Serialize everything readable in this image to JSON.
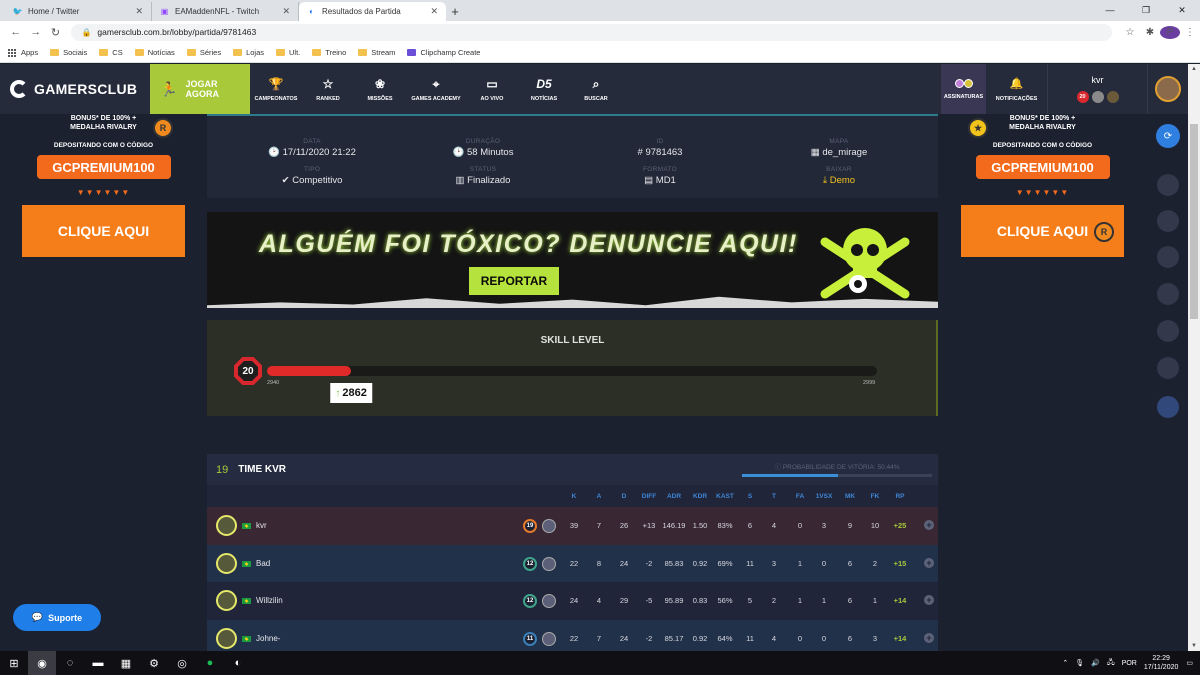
{
  "browser": {
    "tabs": [
      {
        "title": "Home / Twitter",
        "icon": "twitter-icon",
        "active": false
      },
      {
        "title": "EAMaddenNFL - Twitch",
        "icon": "twitch-icon",
        "active": false
      },
      {
        "title": "Resultados da Partida",
        "icon": "gc-icon",
        "active": true
      }
    ],
    "url": "gamersclub.com.br/lobby/partida/9781463",
    "profile_initial": "P",
    "bookmarks": [
      "Apps",
      "Sociais",
      "CS",
      "Notícias",
      "Séries",
      "Lojas",
      "Ult.",
      "Treino",
      "Stream",
      "Clipchamp Create"
    ]
  },
  "site": {
    "logo": "GAMERSCLUB",
    "play_label": "JOGAR AGORA",
    "nav": [
      {
        "label": "CAMPEONATOS",
        "icon": "trophy-icon",
        "glyph": "🏆"
      },
      {
        "label": "RANKED",
        "icon": "star-icon",
        "glyph": "☆"
      },
      {
        "label": "MISSÕES",
        "icon": "medal-icon",
        "glyph": "❀"
      },
      {
        "label": "GAMES ACADEMY",
        "icon": "pin-icon",
        "glyph": "⌖"
      },
      {
        "label": "AO VIVO",
        "icon": "monitor-icon",
        "glyph": "▭"
      },
      {
        "label": "NOTÍCIAS",
        "icon": "news-icon",
        "glyph": "D5"
      },
      {
        "label": "BUSCAR",
        "icon": "search-icon",
        "glyph": "⌕"
      }
    ],
    "subs_label": "ASSINATURAS",
    "notif_label": "NOTIFICAÇÕES",
    "username": "kvr",
    "user_level": "20"
  },
  "ads": {
    "bonus": "BONUS* DE 100% + MEDALHA RIVALRY",
    "code_label": "DEPOSITANDO COM O CÓDIGO",
    "code": "GCPREMIUM100",
    "arrows": "▼▼▼▼▼▼",
    "cta": "CLIQUE AQUI"
  },
  "match": {
    "data_label": "DATA",
    "data": "17/11/2020 21:22",
    "duracao_label": "DURAÇÃO",
    "duracao": "58 Minutos",
    "id_label": "ID",
    "id": "9781463",
    "mapa_label": "MAPA",
    "mapa": "de_mirage",
    "tipo_label": "TIPO",
    "tipo": "Competitivo",
    "status_label": "STATUS",
    "status": "Finalizado",
    "formato_label": "FORMATO",
    "formato": "MD1",
    "baixar_label": "BAIXAR",
    "baixar": "Demo"
  },
  "report": {
    "headline": "ALGUÉM FOI TÓXICO? DENUNCIE AQUI!",
    "button": "REPORTAR"
  },
  "skill": {
    "title": "SKILL LEVEL",
    "level": "20",
    "min": "2940",
    "max": "2999",
    "current": "2862",
    "progress": 0.138
  },
  "team": {
    "number": "19",
    "name": "TIME KVR",
    "win_prob_label": "PROBABILIDADE DE VITÓRIA: 50.44%",
    "win_prob": 0.5044,
    "columns": [
      "K",
      "A",
      "D",
      "DIFF",
      "ADR",
      "KDR",
      "KAST",
      "S",
      "T",
      "FA",
      "1VSX",
      "MK",
      "FK",
      "RP"
    ],
    "players": [
      {
        "name": "kvr",
        "level": "19",
        "badge_color": "#e57a2a",
        "stats": [
          "39",
          "7",
          "26",
          "+13",
          "146.19",
          "1.50",
          "83%",
          "6",
          "4",
          "0",
          "3",
          "9",
          "10",
          "+25"
        ],
        "highlight": "#3a2734"
      },
      {
        "name": "Bad",
        "level": "12",
        "badge_color": "#3fa58a",
        "stats": [
          "22",
          "8",
          "24",
          "-2",
          "85.83",
          "0.92",
          "69%",
          "11",
          "3",
          "1",
          "0",
          "6",
          "2",
          "+15"
        ],
        "highlight": "#22314a"
      },
      {
        "name": "Willzilin",
        "level": "12",
        "badge_color": "#3fa58a",
        "stats": [
          "24",
          "4",
          "29",
          "-5",
          "95.89",
          "0.83",
          "56%",
          "5",
          "2",
          "1",
          "1",
          "6",
          "1",
          "+14"
        ],
        "highlight": "#20253a"
      },
      {
        "name": "Johne-",
        "level": "11",
        "badge_color": "#3a7fb8",
        "stats": [
          "22",
          "7",
          "24",
          "-2",
          "85.17",
          "0.92",
          "64%",
          "11",
          "4",
          "0",
          "0",
          "6",
          "3",
          "+14"
        ],
        "highlight": "#22314a"
      }
    ]
  },
  "support_label": "Suporte",
  "taskbar": {
    "lang": "POR",
    "time": "22:29",
    "date": "17/11/2020"
  }
}
